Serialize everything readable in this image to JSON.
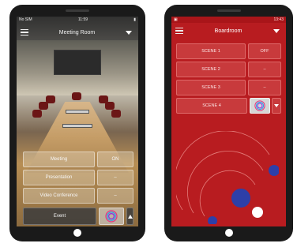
{
  "left_phone": {
    "status": {
      "carrier": "No SIM",
      "time": "11:59"
    },
    "header": {
      "title": "Meeting Room"
    },
    "buttons": [
      {
        "label": "Meeting",
        "value": "ON"
      },
      {
        "label": "Presentation",
        "value": "–"
      },
      {
        "label": "Video Conference",
        "value": "–"
      }
    ],
    "event_label": "Event"
  },
  "right_phone": {
    "status": {
      "time": "13:43"
    },
    "header": {
      "title": "Boardroom"
    },
    "scenes": [
      {
        "label": "SCENE 1",
        "value": "OFF"
      },
      {
        "label": "SCENE 2",
        "value": "–"
      },
      {
        "label": "SCENE 3",
        "value": "–"
      },
      {
        "label": "SCENE 4"
      }
    ]
  },
  "colors": {
    "accent_red": "#b81c20",
    "orbit_blue": "#2d3fa8"
  }
}
